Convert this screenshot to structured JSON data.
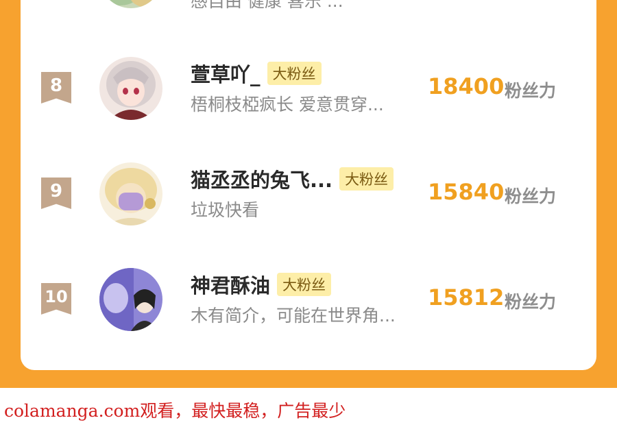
{
  "partial_row": {
    "bio": "感自由 健康 喜乐 ..."
  },
  "rows": [
    {
      "rank": "8",
      "name": "萱草吖_",
      "badge": "大粉丝",
      "bio": "梧桐枝椏疯长 爱意贯穿...",
      "score": "18400",
      "unit": "粉丝力"
    },
    {
      "rank": "9",
      "name": "猫丞丞的兔飞...",
      "badge": "大粉丝",
      "bio": "垃圾快看",
      "score": "15840",
      "unit": "粉丝力"
    },
    {
      "rank": "10",
      "name": "神君酥油",
      "badge": "大粉丝",
      "bio": "木有简介，可能在世界角...",
      "score": "15812",
      "unit": "粉丝力"
    }
  ],
  "watermark": "colamanga.com观看，最快最稳，广告最少",
  "colors": {
    "frame": "#f7a22f",
    "score": "#f0a020",
    "badge_bg": "#fdeea8",
    "rank_bg": "#c3a68c"
  }
}
